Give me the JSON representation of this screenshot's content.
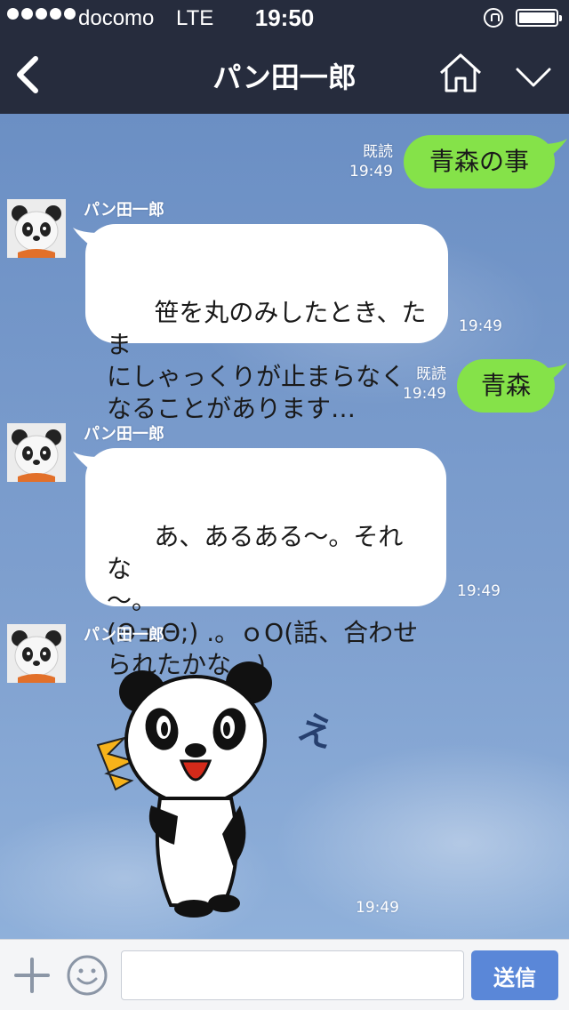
{
  "status_bar": {
    "signal_dots": 5,
    "carrier": "docomo",
    "network": "LTE",
    "time": "19:50"
  },
  "header": {
    "title": "パン田一郎",
    "icons": [
      "back-chevron-icon",
      "home-icon",
      "chevron-down-icon"
    ]
  },
  "messages": [
    {
      "direction": "out",
      "read_label": "既読",
      "time": "19:49",
      "text": "青森の事"
    },
    {
      "direction": "in",
      "sender": "パン田一郎",
      "time": "19:49",
      "text": "笹を丸のみしたとき、たま\nにしゃっくりが止まらなく\nなることがあります…"
    },
    {
      "direction": "out",
      "read_label": "既読",
      "time": "19:49",
      "text": "青森"
    },
    {
      "direction": "in",
      "sender": "パン田一郎",
      "time": "19:49",
      "text": "あ、あるある〜。それな\n〜。\n(ΘェΘ;) .。ｏO(話、合わせ\nられたかな…)"
    },
    {
      "direction": "in",
      "sender": "パン田一郎",
      "time": "19:49",
      "sticker": "panda-surprised-sticker",
      "sticker_text": "えっ!?"
    }
  ],
  "input_bar": {
    "placeholder": "",
    "send_label": "送信",
    "icons": [
      "plus-icon",
      "smiley-icon"
    ]
  },
  "colors": {
    "header_bg": "#262c3d",
    "outgoing_bubble": "#85e249",
    "incoming_bubble": "#ffffff",
    "send_button": "#5a87d8"
  }
}
